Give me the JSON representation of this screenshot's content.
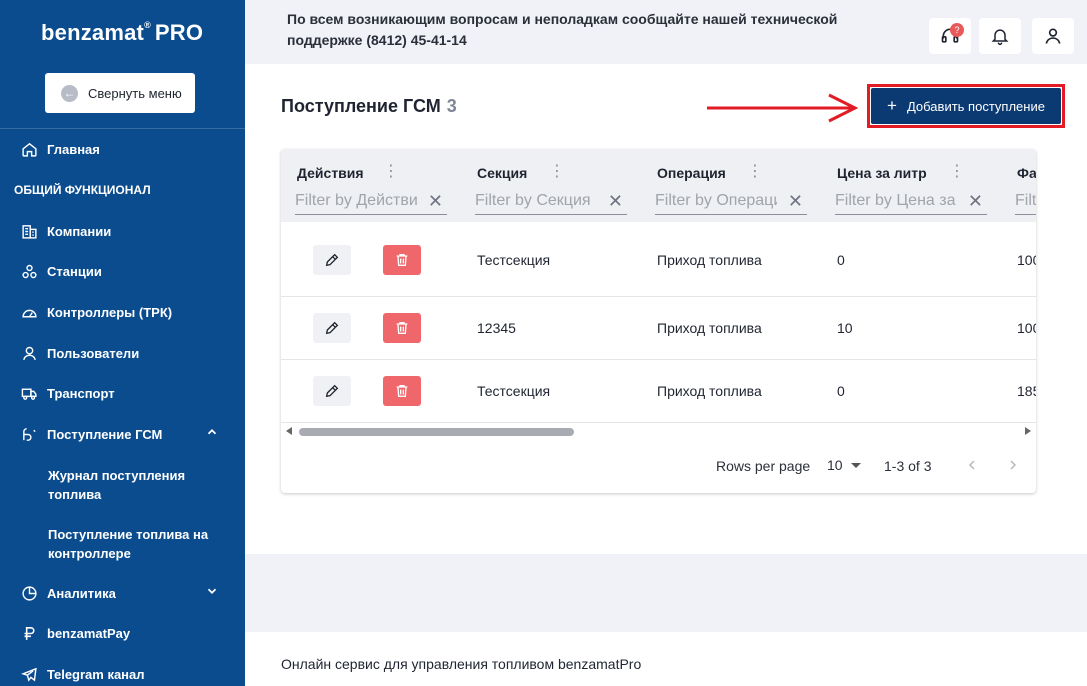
{
  "brand": {
    "name": "benzamat",
    "sup": "®",
    "pro": "PRO"
  },
  "sidebar": {
    "collapse_label": "Свернуть меню",
    "items": [
      {
        "label": "Главная",
        "icon": "home-icon"
      },
      {
        "label": "Компании",
        "icon": "building-icon"
      },
      {
        "label": "Станции",
        "icon": "stations-icon"
      },
      {
        "label": "Контроллеры (ТРК)",
        "icon": "gauge-icon"
      },
      {
        "label": "Пользователи",
        "icon": "user-icon"
      },
      {
        "label": "Транспорт",
        "icon": "truck-icon"
      },
      {
        "label": "Поступление ГСМ",
        "icon": "fuel-icon"
      },
      {
        "label": "Аналитика",
        "icon": "pie-icon"
      },
      {
        "label": "benzamatPay",
        "icon": "ruble-icon"
      },
      {
        "label": "Telegram канал",
        "icon": "telegram-icon"
      }
    ],
    "section_label": "Общий функционал",
    "sub_items": [
      {
        "label": "Журнал поступления топлива"
      },
      {
        "label": "Поступление топлива на контроллере"
      }
    ]
  },
  "header": {
    "notice": "По всем возникающим вопросам и неполадкам сообщайте нашей технической поддержке (8412) 45-41-14",
    "support_badge": "?"
  },
  "main": {
    "title": "Поступление ГСМ",
    "count": "3",
    "add_button": "Добавить поступление"
  },
  "table": {
    "columns": [
      {
        "label": "Действия",
        "filter_placeholder": "Filter by Действия"
      },
      {
        "label": "Секция",
        "filter_placeholder": "Filter by Секция"
      },
      {
        "label": "Операция",
        "filter_placeholder": "Filter by Операция"
      },
      {
        "label": "Цена за литр",
        "filter_placeholder": "Filter by Цена за литр"
      },
      {
        "label": "Фа",
        "filter_placeholder": "Filt"
      }
    ],
    "rows": [
      {
        "section": "Тестсекция",
        "operation": "Приход топлива",
        "price": "0",
        "fact": "100"
      },
      {
        "section": "12345",
        "operation": "Приход топлива",
        "price": "10",
        "fact": "100"
      },
      {
        "section": "Тестсекция",
        "operation": "Приход топлива",
        "price": "0",
        "fact": "185"
      }
    ],
    "pagination": {
      "rows_per_page_label": "Rows per page",
      "rows_per_page_value": "10",
      "range": "1-3 of 3"
    }
  },
  "footer": {
    "text": "Онлайн сервис для управления топливом benzamatPro"
  },
  "colors": {
    "sidebar": "#0b4c8f",
    "primary_button": "#0b3a73",
    "delete": "#f0676b",
    "highlight": "#e21b24"
  }
}
